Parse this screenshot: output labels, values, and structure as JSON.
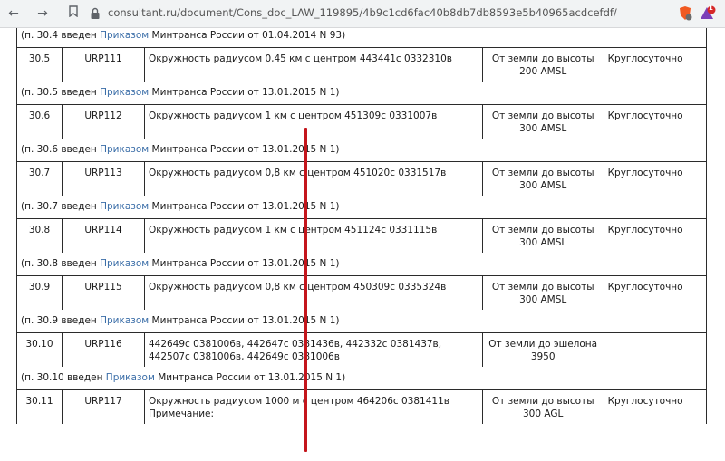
{
  "browser": {
    "url": "consultant.ru/document/Cons_doc_LAW_119895/4b9c1cd6fac40b8db7db8593e5b40965acdcefdf/",
    "badge_count": "1"
  },
  "colors": {
    "annotation": "#c4161c",
    "link": "#3b6ea8"
  },
  "table": {
    "top_note": {
      "prefix": "(п. 30.4 введен ",
      "link": "Приказом",
      "suffix": " Минтранса России от 01.04.2014 N 93)"
    },
    "rows": [
      {
        "num": "30.5",
        "code": "URP111",
        "desc": "Окружность радиусом 0,45 км с центром 443441с 0332310в",
        "height": "От земли до высоты 200 AMSL",
        "time": "Круглосуточно",
        "note": {
          "prefix": "(п. 30.5 введен ",
          "link": "Приказом",
          "suffix": " Минтранса России от 13.01.2015 N 1)"
        }
      },
      {
        "num": "30.6",
        "code": "URP112",
        "desc": "Окружность радиусом 1 км с центром 451309с 0331007в",
        "height": "От земли до высоты 300 AMSL",
        "time": "Круглосуточно",
        "note": {
          "prefix": "(п. 30.6 введен ",
          "link": "Приказом",
          "suffix": " Минтранса России от 13.01.2015 N 1)"
        }
      },
      {
        "num": "30.7",
        "code": "URP113",
        "desc": "Окружность радиусом 0,8 км с центром 451020с 0331517в",
        "height": "От земли до высоты 300 AMSL",
        "time": "Круглосуточно",
        "note": {
          "prefix": "(п. 30.7 введен ",
          "link": "Приказом",
          "suffix": " Минтранса России от 13.01.2015 N 1)"
        }
      },
      {
        "num": "30.8",
        "code": "URP114",
        "desc": "Окружность радиусом 1 км с центром 451124с 0331115в",
        "height": "От земли до высоты 300 AMSL",
        "time": "Круглосуточно",
        "note": {
          "prefix": "(п. 30.8 введен ",
          "link": "Приказом",
          "suffix": " Минтранса России от 13.01.2015 N 1)"
        }
      },
      {
        "num": "30.9",
        "code": "URP115",
        "desc": "Окружность радиусом 0,8 км с центром 450309с 0335324в",
        "height": "От земли до высоты 300 AMSL",
        "time": "Круглосуточно",
        "note": {
          "prefix": "(п. 30.9 введен ",
          "link": "Приказом",
          "suffix": " Минтранса России от 13.01.2015 N 1)"
        }
      },
      {
        "num": "30.10",
        "code": "URP116",
        "desc": "442649с 0381006в, 442647с 0381436в, 442332с 0381437в, 442507с 0381006в, 442649с 0381006в",
        "height": "От земли до эшелона 3950",
        "time": "",
        "note": {
          "prefix": "(п. 30.10 введен ",
          "link": "Приказом",
          "suffix": " Минтранса России от 13.01.2015 N 1)"
        }
      },
      {
        "num": "30.11",
        "code": "URP117",
        "desc": "Окружность радиусом 1000 м с центром 464206с 0381411в",
        "desc_extra": "Примечание:",
        "height": "От земли до высоты 300 AGL",
        "time": "Круглосуточно"
      }
    ]
  }
}
